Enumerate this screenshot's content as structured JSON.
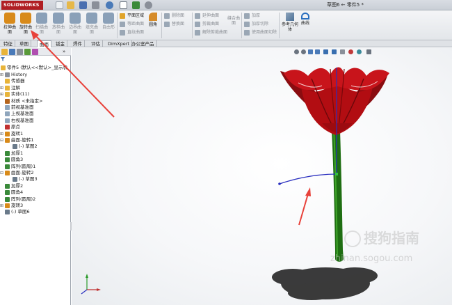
{
  "titlebar": {
    "logo": "SOLIDWORKS",
    "document_title": "草图6 ← 零件5 *"
  },
  "ribbon": {
    "features": [
      {
        "label": "拉伸曲面",
        "color": "#d88a1a",
        "dim": false
      },
      {
        "label": "旋转曲面",
        "color": "#d88a1a",
        "dim": false
      },
      {
        "label": "扫描曲面",
        "color": "#8aa0b8",
        "dim": true
      },
      {
        "label": "放样曲面",
        "color": "#8aa0b8",
        "dim": true
      },
      {
        "label": "边界曲面",
        "color": "#8aa0b8",
        "dim": true
      },
      {
        "label": "填充曲面",
        "color": "#8aa0b8",
        "dim": true
      },
      {
        "label": "自由形",
        "color": "#8aa0b8",
        "dim": true
      }
    ],
    "col1": [
      {
        "label": "平面区域",
        "color": "#e0a42a",
        "dim": false
      },
      {
        "label": "等距曲面",
        "color": "#9aa7b5",
        "dim": true
      },
      {
        "label": "直纹曲面",
        "color": "#9aa7b5",
        "dim": true
      }
    ],
    "fillet": {
      "label": "圆角",
      "color": "#d68c2a"
    },
    "col2": [
      {
        "label": "删除面",
        "color": "#9aa7b5",
        "dim": true
      },
      {
        "label": "替换面",
        "color": "#9aa7b5",
        "dim": true
      }
    ],
    "col3": [
      {
        "label": "延伸曲面",
        "color": "#9aa7b5",
        "dim": true
      },
      {
        "label": "剪裁曲面",
        "color": "#9aa7b5",
        "dim": true
      },
      {
        "label": "解除剪裁曲面",
        "color": "#9aa7b5",
        "dim": true
      }
    ],
    "knit": {
      "label": "缝合曲面"
    },
    "col4": [
      {
        "label": "加厚",
        "color": "#9aa7b5",
        "dim": true
      },
      {
        "label": "加厚切除",
        "color": "#9aa7b5",
        "dim": true
      },
      {
        "label": "使用曲面切除",
        "color": "#9aa7b5",
        "dim": true
      }
    ],
    "refgeo": {
      "label": "参考几何体"
    },
    "curves": {
      "label": "曲线"
    }
  },
  "tabs": [
    {
      "label": "特征",
      "active": false
    },
    {
      "label": "草图",
      "active": false
    },
    {
      "label": "曲面",
      "active": true
    },
    {
      "label": "钣金",
      "active": false
    },
    {
      "label": "焊件",
      "active": false
    },
    {
      "label": "评估",
      "active": false
    },
    {
      "label": "DimXpert",
      "active": false
    },
    {
      "label": "办公室产品",
      "active": false
    }
  ],
  "tree": {
    "root": "零件5 (默认<<默认>_显示状",
    "items": [
      {
        "label": "History",
        "color": "#8a8f99",
        "expander": "+",
        "indent": 0
      },
      {
        "label": "传感器",
        "color": "#e8b43a",
        "expander": "",
        "indent": 0
      },
      {
        "label": "注解",
        "color": "#e8b43a",
        "expander": "+",
        "indent": 0
      },
      {
        "label": "实体(11)",
        "color": "#e8b43a",
        "expander": "+",
        "indent": 0
      },
      {
        "label": "材质 <未指定>",
        "color": "#b5651d",
        "expander": "",
        "indent": 0
      },
      {
        "label": "前视基准面",
        "color": "#8fa6bd",
        "expander": "",
        "indent": 0
      },
      {
        "label": "上视基准面",
        "color": "#8fa6bd",
        "expander": "",
        "indent": 0
      },
      {
        "label": "右视基准面",
        "color": "#8fa6bd",
        "expander": "",
        "indent": 0
      },
      {
        "label": "原点",
        "color": "#c03030",
        "expander": "",
        "indent": 0
      },
      {
        "label": "旋转1",
        "color": "#d88a1a",
        "expander": "+",
        "indent": 0
      },
      {
        "label": "曲面-旋转1",
        "color": "#d88a1a",
        "expander": "-",
        "indent": 0
      },
      {
        "label": "(-) 草图2",
        "color": "#6a7a8a",
        "expander": "",
        "indent": 1
      },
      {
        "label": "加厚1",
        "color": "#3a8a3a",
        "expander": "",
        "indent": 0
      },
      {
        "label": "圆角3",
        "color": "#3a8a3a",
        "expander": "",
        "indent": 0
      },
      {
        "label": "阵列(圆周)1",
        "color": "#3a8a3a",
        "expander": "",
        "indent": 0
      },
      {
        "label": "曲面-旋转2",
        "color": "#d88a1a",
        "expander": "-",
        "indent": 0
      },
      {
        "label": "(-) 草图3",
        "color": "#6a7a8a",
        "expander": "",
        "indent": 1
      },
      {
        "label": "加厚2",
        "color": "#3a8a3a",
        "expander": "",
        "indent": 0
      },
      {
        "label": "圆角4",
        "color": "#3a8a3a",
        "expander": "",
        "indent": 0
      },
      {
        "label": "阵列(圆周)2",
        "color": "#3a8a3a",
        "expander": "",
        "indent": 0
      },
      {
        "label": "旋转3",
        "color": "#d88a1a",
        "expander": "+",
        "indent": 0
      },
      {
        "label": "(-) 草图6",
        "color": "#6a7a8a",
        "expander": "",
        "indent": 0
      }
    ]
  },
  "watermark": {
    "text": "搜狗指南",
    "url": "zhinan.sogou.com"
  },
  "colors": {
    "flower": "#b20d12",
    "stem": "#1f6e12",
    "axis": "#2a2fbf",
    "annotation_arrow": "#e8413a",
    "selected_tab": "#ffffff"
  }
}
